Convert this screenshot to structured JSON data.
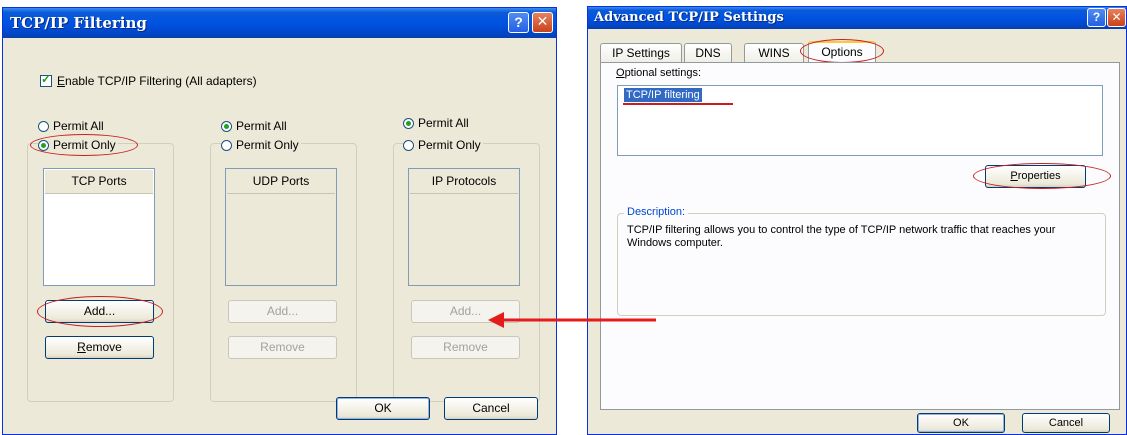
{
  "left_dialog": {
    "title": "TCP/IP Filtering",
    "help_glyph": "?",
    "close_glyph": "✕",
    "enable_checkbox": {
      "label": "Enable TCP/IP Filtering (All adapters)",
      "accel": "E",
      "rest": "nable TCP/IP Filtering (All adapters)",
      "checked": true
    },
    "tcp": {
      "permit_all": "Permit All",
      "permit_only": "Permit Only",
      "selected": "permit_only",
      "column": "TCP Ports",
      "add": "Add...",
      "remove": "Remove"
    },
    "udp": {
      "permit_all": "Permit All",
      "permit_only": "Permit Only",
      "selected": "permit_all",
      "column": "UDP Ports",
      "add": "Add...",
      "remove": "Remove"
    },
    "ip": {
      "permit_all": "Permit All",
      "permit_only": "Permit Only",
      "selected": "permit_all",
      "column": "IP Protocols",
      "add": "Add...",
      "remove": "Remove"
    },
    "ok": "OK",
    "cancel": "Cancel"
  },
  "right_dialog": {
    "title": "Advanced TCP/IP Settings",
    "help_glyph": "?",
    "close_glyph": "✕",
    "tabs": [
      "IP Settings",
      "DNS",
      "WINS",
      "Options"
    ],
    "active_tab": "Options",
    "optional_settings_label": "Optional settings:",
    "list_items": [
      "TCP/IP filtering"
    ],
    "properties_button": "Properties",
    "description_label": "Description:",
    "description_text": "TCP/IP filtering allows you to control the type of TCP/IP network traffic that reaches your Windows computer.",
    "ok": "OK",
    "cancel": "Cancel"
  },
  "colors": {
    "annotation": "#c81e1e",
    "xp_title": "#0053e2",
    "xp_face": "#ece9d8"
  }
}
